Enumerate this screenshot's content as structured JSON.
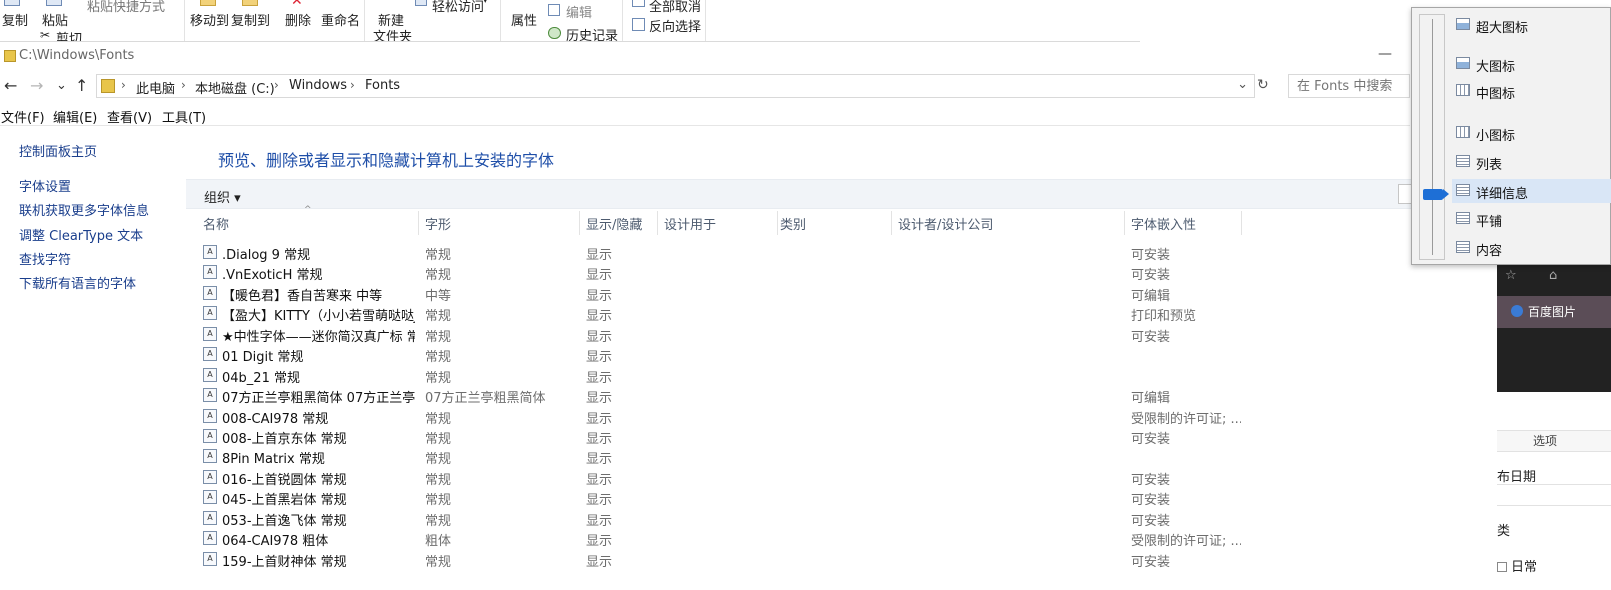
{
  "window": {
    "title": "C:\\Windows\\Fonts",
    "minimize_glyph": "—"
  },
  "ribbon": {
    "copy": "复制",
    "paste": "粘贴",
    "paste_shortcut": "粘贴快捷方式",
    "cut": "剪切",
    "move_to": "移动到",
    "copy_to": "复制到",
    "delete": "删除",
    "rename": "重命名",
    "new_folder_1": "新建",
    "new_folder_2": "文件夹",
    "easy_access": "轻松访问",
    "properties": "属性",
    "edit": "编辑",
    "history": "历史记录",
    "select_none": "全部取消",
    "invert_selection": "反向选择"
  },
  "nav": {
    "back": "←",
    "forward": "→",
    "recent": "⌄",
    "up": "↑",
    "crumbs": [
      "此电脑",
      "本地磁盘 (C:)",
      "Windows",
      "Fonts"
    ],
    "crumb_sep": "›",
    "dropdown": "⌄",
    "refresh": "↻",
    "search_placeholder": "在 Fonts 中搜索"
  },
  "menubar": {
    "file": "文件(F)",
    "edit": "编辑(E)",
    "view": "查看(V)",
    "tools": "工具(T)"
  },
  "sidebar": {
    "home": "控制面板主页",
    "links": [
      "字体设置",
      "联机获取更多字体信息",
      "调整 ClearType 文本",
      "查找字符",
      "下载所有语言的字体"
    ]
  },
  "content": {
    "title": "预览、删除或者显示和隐藏计算机上安装的字体",
    "organize": "组织 ▾",
    "sort_arrow": "^",
    "columns": [
      "名称",
      "字形",
      "显示/隐藏",
      "设计用于",
      "类别",
      "设计者/设计公司",
      "字体嵌入性"
    ],
    "file_icon_glyph": "A",
    "rows": [
      {
        "name": ".Dialog 9 常规",
        "style": "常规",
        "show": "显示",
        "embed": "可安装"
      },
      {
        "name": ".VnExoticH 常规",
        "style": "常规",
        "show": "显示",
        "embed": "可安装"
      },
      {
        "name": "【暖色君】香自苦寒来 中等",
        "style": "中等",
        "show": "显示",
        "embed": "可编辑"
      },
      {
        "name": "【盈大】KITTY（小小若雪萌哒哒Ji...",
        "style": "常规",
        "show": "显示",
        "embed": "打印和预览"
      },
      {
        "name": "★中性字体——迷你简汉真广标 常...",
        "style": "常规",
        "show": "显示",
        "embed": "可安装"
      },
      {
        "name": "01 Digit 常规",
        "style": "常规",
        "show": "显示",
        "embed": ""
      },
      {
        "name": "04b_21 常规",
        "style": "常规",
        "show": "显示",
        "embed": ""
      },
      {
        "name": "07方正兰亭粗黑简体 07方正兰亭...",
        "style": "07方正兰亭粗黑简体",
        "show": "显示",
        "embed": "可编辑"
      },
      {
        "name": "008-CAI978 常规",
        "style": "常规",
        "show": "显示",
        "embed": "受限制的许可证; ..."
      },
      {
        "name": "008-上首京东体 常规",
        "style": "常规",
        "show": "显示",
        "embed": "可安装"
      },
      {
        "name": "8Pin Matrix 常规",
        "style": "常规",
        "show": "显示",
        "embed": ""
      },
      {
        "name": "016-上首锐圆体 常规",
        "style": "常规",
        "show": "显示",
        "embed": "可安装"
      },
      {
        "name": "045-上首黑岩体 常规",
        "style": "常规",
        "show": "显示",
        "embed": "可安装"
      },
      {
        "name": "053-上首逸飞体 常规",
        "style": "常规",
        "show": "显示",
        "embed": "可安装"
      },
      {
        "name": "064-CAI978 粗体",
        "style": "粗体",
        "show": "显示",
        "embed": "受限制的许可证; ..."
      },
      {
        "name": "159-上首财神体 常规",
        "style": "常规",
        "show": "显示",
        "embed": "可安装"
      }
    ]
  },
  "view_menu": {
    "items": [
      "超大图标",
      "大图标",
      "中图标",
      "小图标",
      "列表",
      "详细信息",
      "平铺",
      "内容"
    ],
    "selected": "详细信息"
  },
  "background_app": {
    "baidu_bar": "百度图片",
    "options": "选项",
    "date_label": "布日期",
    "category_label": "类",
    "daily": "日常"
  }
}
